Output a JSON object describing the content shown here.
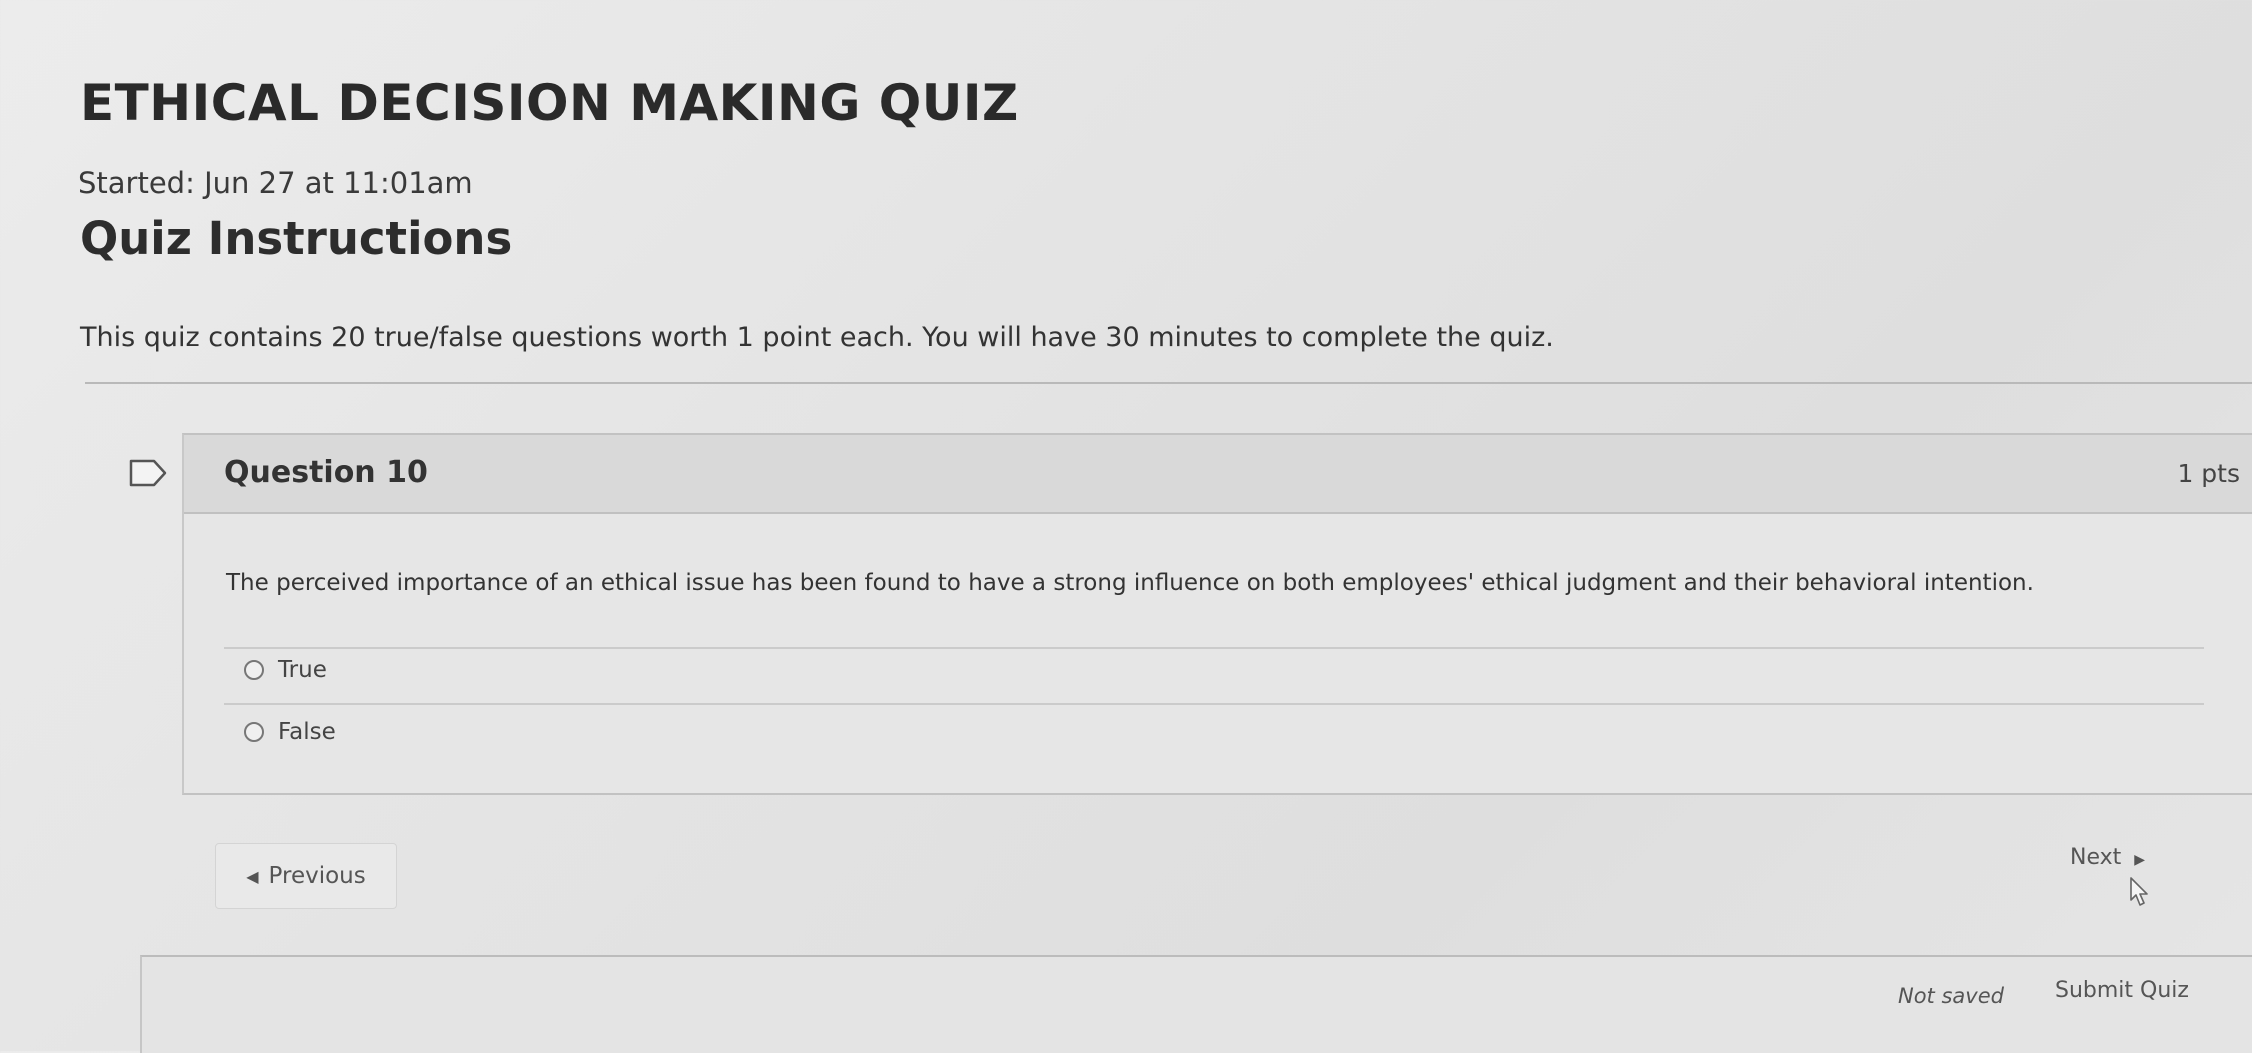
{
  "header": {
    "quiz_title": "ETHICAL DECISION MAKING QUIZ",
    "started": "Started: Jun 27 at 11:01am"
  },
  "instructions": {
    "heading": "Quiz Instructions",
    "text": "This quiz contains 20 true/false questions worth 1 point each. You will have 30 minutes to complete the quiz."
  },
  "question": {
    "title": "Question 10",
    "points": "1 pts",
    "text": "The perceived importance of an ethical issue has been found to have a strong influence on both employees' ethical judgment and their behavioral intention.",
    "answers": [
      {
        "label": "True",
        "selected": false
      },
      {
        "label": "False",
        "selected": false
      }
    ]
  },
  "navigation": {
    "previous_label": "Previous",
    "previous_icon": "left-triangle-icon",
    "next_label": "Next"
  },
  "footer": {
    "status": "Not saved",
    "submit_label": "Submit Quiz"
  }
}
